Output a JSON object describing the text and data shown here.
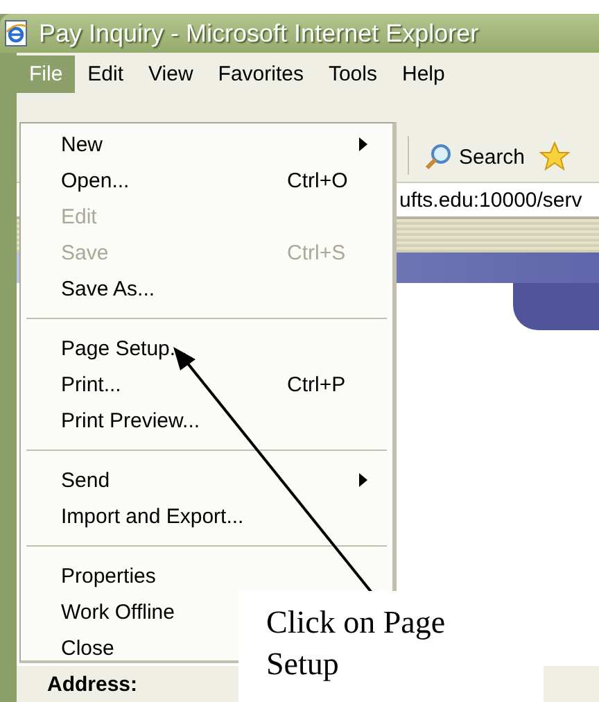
{
  "window": {
    "title": "Pay Inquiry - Microsoft Internet Explorer"
  },
  "menu_bar": [
    {
      "label": "File",
      "selected": true
    },
    {
      "label": "Edit",
      "selected": false
    },
    {
      "label": "View",
      "selected": false
    },
    {
      "label": "Favorites",
      "selected": false
    },
    {
      "label": "Tools",
      "selected": false
    },
    {
      "label": "Help",
      "selected": false
    }
  ],
  "file_menu": {
    "groups": [
      [
        {
          "label": "New",
          "submenu": true,
          "disabled": false
        },
        {
          "label": "Open...",
          "shortcut": "Ctrl+O",
          "submenu": false,
          "disabled": false
        },
        {
          "label": "Edit",
          "submenu": false,
          "disabled": true
        },
        {
          "label": "Save",
          "shortcut": "Ctrl+S",
          "submenu": false,
          "disabled": true
        },
        {
          "label": "Save As...",
          "submenu": false,
          "disabled": false
        }
      ],
      [
        {
          "label": "Page Setup...",
          "submenu": false,
          "disabled": false
        },
        {
          "label": "Print...",
          "shortcut": "Ctrl+P",
          "submenu": false,
          "disabled": false
        },
        {
          "label": "Print Preview...",
          "submenu": false,
          "disabled": false
        }
      ],
      [
        {
          "label": "Send",
          "submenu": true,
          "disabled": false
        },
        {
          "label": "Import and Export...",
          "submenu": false,
          "disabled": false
        }
      ],
      [
        {
          "label": "Properties",
          "submenu": false,
          "disabled": false
        },
        {
          "label": "Work Offline",
          "submenu": false,
          "disabled": false
        },
        {
          "label": "Close",
          "submenu": false,
          "disabled": false
        }
      ]
    ]
  },
  "toolbar": {
    "search": "Search"
  },
  "address_bar": {
    "url": "ufts.edu:10000/serv",
    "label": "Address:"
  },
  "callout": {
    "text": "Click on Page Setup"
  }
}
